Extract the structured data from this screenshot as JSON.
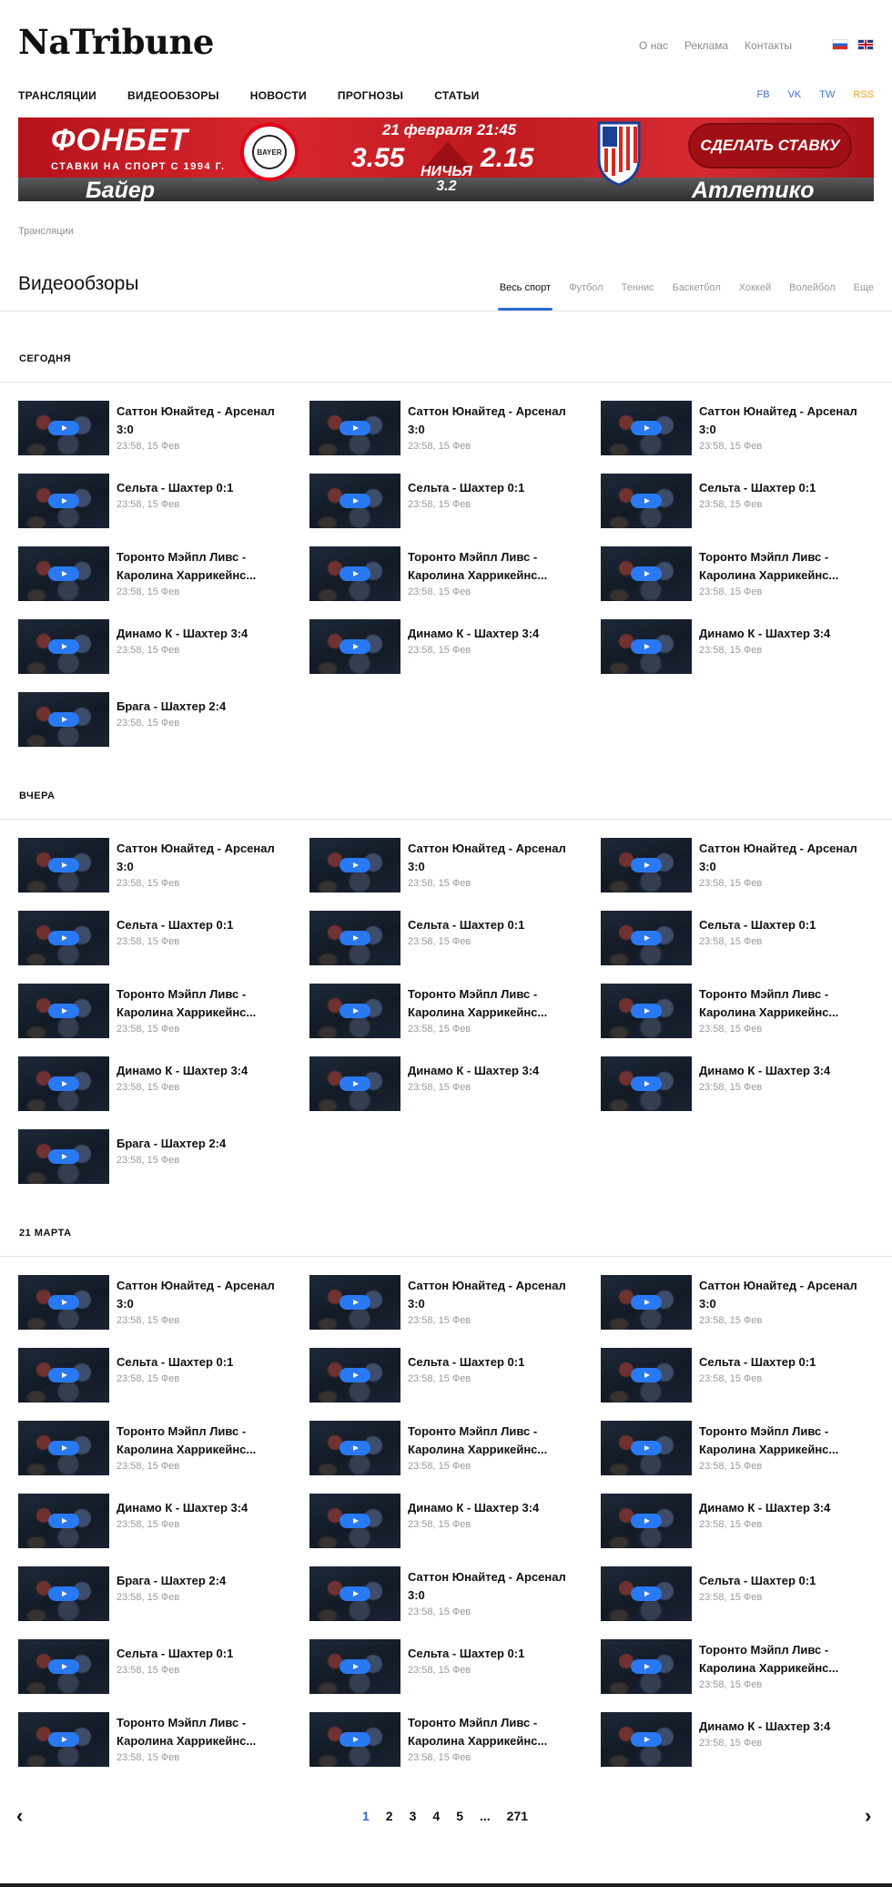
{
  "header": {
    "logo": "NaTribune",
    "top_links": [
      "О нас",
      "Реклама",
      "Контакты"
    ],
    "flags": [
      "ru-flag-icon",
      "uk-flag-icon"
    ]
  },
  "nav": {
    "items": [
      "Трансляции",
      "Видеообзоры",
      "Новости",
      "Прогнозы",
      "Статьи"
    ],
    "social": [
      "FB",
      "VK",
      "TW",
      "RSS"
    ]
  },
  "banner": {
    "brand": "ФОНБЕТ",
    "tagline": "СТАВКИ НА СПОРТ С 1994 Г.",
    "date": "21 февраля 21:45",
    "coef1": "3.55",
    "coef2": "2.15",
    "draw_label": "НИЧЬЯ",
    "draw_value": "3.2",
    "team1": "Байер",
    "team2": "Атлетико",
    "cta": "СДЕЛАТЬ СТАВКУ",
    "bayer_year": "1904",
    "bayer_name": "BAYER",
    "bayer_city": "Leverkusen",
    "colors": {
      "red": "#c8161e",
      "dark": "#2e2e2e"
    }
  },
  "breadcrumb": "Трансляции",
  "page_title": "Видеообзоры",
  "tabs": [
    "Весь спорт",
    "Футбол",
    "Теннис",
    "Баскетбол",
    "Хоккей",
    "Волейбол",
    "Еще"
  ],
  "accent_color": "#2b6bd9",
  "sections": [
    {
      "label": "СЕГОДНЯ",
      "items": [
        {
          "title": "Саттон Юнайтед - Арсенал 3:0",
          "time": "23:58, 15 Фев"
        },
        {
          "title": "Саттон Юнайтед - Арсенал 3:0",
          "time": "23:58, 15 Фев"
        },
        {
          "title": "Саттон Юнайтед - Арсенал 3:0",
          "time": "23:58, 15 Фев"
        },
        {
          "title": "Сельта - Шахтер 0:1",
          "time": "23:58, 15 Фев"
        },
        {
          "title": "Сельта - Шахтер 0:1",
          "time": "23:58, 15 Фев"
        },
        {
          "title": "Сельта - Шахтер 0:1",
          "time": "23:58, 15 Фев"
        },
        {
          "title": "Торонто Мэйпл Ливс - Каролина Харрикейнс...",
          "time": "23:58, 15 Фев"
        },
        {
          "title": "Торонто Мэйпл Ливс - Каролина Харрикейнс...",
          "time": "23:58, 15 Фев"
        },
        {
          "title": "Торонто Мэйпл Ливс - Каролина Харрикейнс...",
          "time": "23:58, 15 Фев"
        },
        {
          "title": "Динамо К - Шахтер 3:4",
          "time": "23:58, 15 Фев"
        },
        {
          "title": "Динамо К - Шахтер 3:4",
          "time": "23:58, 15 Фев"
        },
        {
          "title": "Динамо К - Шахтер 3:4",
          "time": "23:58, 15 Фев"
        },
        {
          "title": "Брага - Шахтер 2:4",
          "time": "23:58, 15 Фев"
        }
      ]
    },
    {
      "label": "ВЧЕРА",
      "items": [
        {
          "title": "Саттон Юнайтед - Арсенал 3:0",
          "time": "23:58, 15 Фев"
        },
        {
          "title": "Саттон Юнайтед - Арсенал 3:0",
          "time": "23:58, 15 Фев"
        },
        {
          "title": "Саттон Юнайтед - Арсенал 3:0",
          "time": "23:58, 15 Фев"
        },
        {
          "title": "Сельта - Шахтер 0:1",
          "time": "23:58, 15 Фев"
        },
        {
          "title": "Сельта - Шахтер 0:1",
          "time": "23:58, 15 Фев"
        },
        {
          "title": "Сельта - Шахтер 0:1",
          "time": "23:58, 15 Фев"
        },
        {
          "title": "Торонто Мэйпл Ливс - Каролина Харрикейнс...",
          "time": "23:58, 15 Фев"
        },
        {
          "title": "Торонто Мэйпл Ливс - Каролина Харрикейнс...",
          "time": "23:58, 15 Фев"
        },
        {
          "title": "Торонто Мэйпл Ливс - Каролина Харрикейнс...",
          "time": "23:58, 15 Фев"
        },
        {
          "title": "Динамо К - Шахтер 3:4",
          "time": "23:58, 15 Фев"
        },
        {
          "title": "Динамо К - Шахтер 3:4",
          "time": "23:58, 15 Фев"
        },
        {
          "title": "Динамо К - Шахтер 3:4",
          "time": "23:58, 15 Фев"
        },
        {
          "title": "Брага - Шахтер 2:4",
          "time": "23:58, 15 Фев"
        }
      ]
    },
    {
      "label": "21 МАРТА",
      "items": [
        {
          "title": "Саттон Юнайтед - Арсенал 3:0",
          "time": "23:58, 15 Фев"
        },
        {
          "title": "Саттон Юнайтед - Арсенал 3:0",
          "time": "23:58, 15 Фев"
        },
        {
          "title": "Саттон Юнайтед - Арсенал 3:0",
          "time": "23:58, 15 Фев"
        },
        {
          "title": "Сельта - Шахтер 0:1",
          "time": "23:58, 15 Фев"
        },
        {
          "title": "Сельта - Шахтер 0:1",
          "time": "23:58, 15 Фев"
        },
        {
          "title": "Сельта - Шахтер 0:1",
          "time": "23:58, 15 Фев"
        },
        {
          "title": "Торонто Мэйпл Ливс - Каролина Харрикейнс...",
          "time": "23:58, 15 Фев"
        },
        {
          "title": "Торонто Мэйпл Ливс - Каролина Харрикейнс...",
          "time": "23:58, 15 Фев"
        },
        {
          "title": "Торонто Мэйпл Ливс - Каролина Харрикейнс...",
          "time": "23:58, 15 Фев"
        },
        {
          "title": "Динамо К - Шахтер 3:4",
          "time": "23:58, 15 Фев"
        },
        {
          "title": "Динамо К - Шахтер 3:4",
          "time": "23:58, 15 Фев"
        },
        {
          "title": "Динамо К - Шахтер 3:4",
          "time": "23:58, 15 Фев"
        },
        {
          "title": "Брага - Шахтер 2:4",
          "time": "23:58, 15 Фев"
        },
        {
          "title": "Саттон Юнайтед - Арсенал 3:0",
          "time": "23:58, 15 Фев"
        },
        {
          "title": "Сельта - Шахтер 0:1",
          "time": "23:58, 15 Фев"
        },
        {
          "title": "Сельта - Шахтер 0:1",
          "time": "23:58, 15 Фев"
        },
        {
          "title": "Сельта - Шахтер 0:1",
          "time": "23:58, 15 Фев"
        },
        {
          "title": "Торонто Мэйпл Ливс - Каролина Харрикейнс...",
          "time": "23:58, 15 Фев"
        },
        {
          "title": "Торонто Мэйпл Ливс - Каролина Харрикейнс...",
          "time": "23:58, 15 Фев"
        },
        {
          "title": "Торонто Мэйпл Ливс - Каролина Харрикейнс...",
          "time": "23:58, 15 Фев"
        },
        {
          "title": "Динамо К - Шахтер 3:4",
          "time": "23:58, 15 Фев"
        }
      ]
    }
  ],
  "pagination": {
    "pages": [
      "1",
      "2",
      "3",
      "4",
      "5",
      "...",
      "271"
    ],
    "current": "1",
    "prev_icon": "chevron-left-icon",
    "next_icon": "chevron-right-icon"
  }
}
